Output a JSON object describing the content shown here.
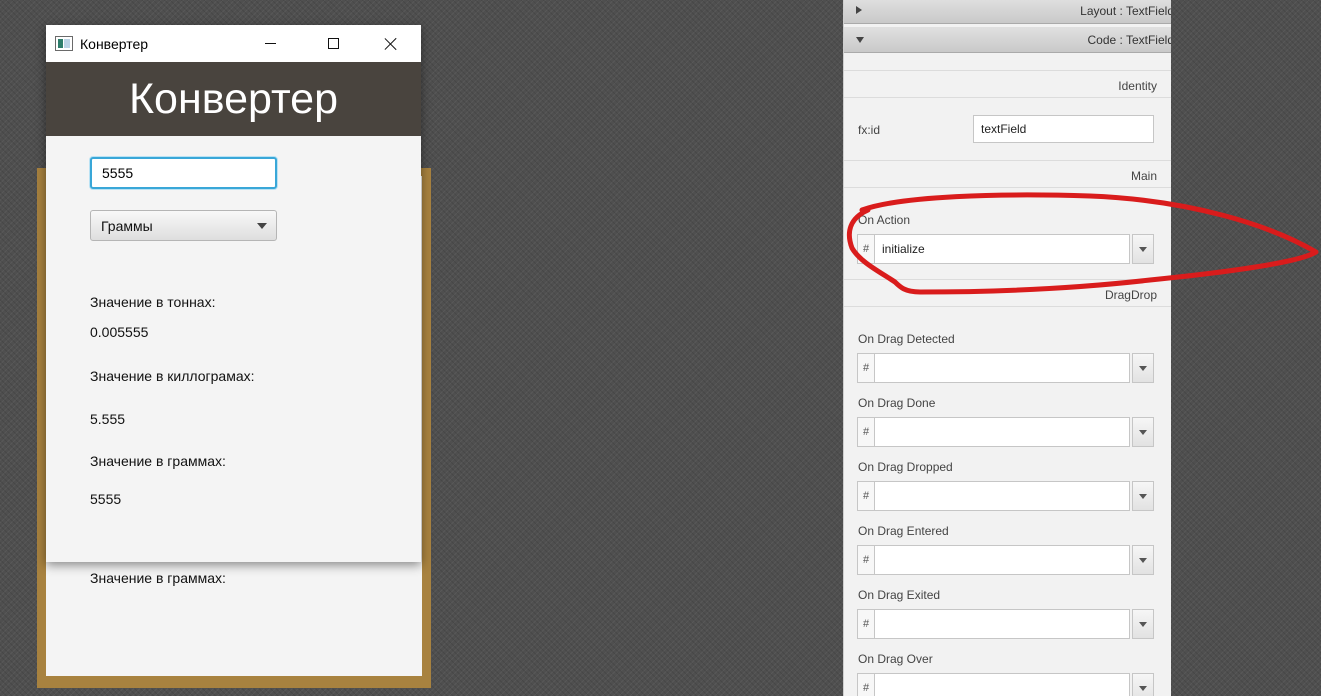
{
  "window": {
    "title": "Конвертер",
    "header_title": "Конвертер"
  },
  "form": {
    "input_value": "5555",
    "unit_selected": "Граммы",
    "tons_label": "Значение в тоннах:",
    "tons_value": "0.005555",
    "kilograms_label": "Значение в киллограмах:",
    "kilograms_value": "5.555",
    "grams_label": "Значение в граммах:",
    "grams_value": "5555"
  },
  "canvas": {
    "grams_label": "Значение в граммах:"
  },
  "inspector": {
    "layout_header": "Layout : TextField",
    "code_header": "Code : TextField",
    "identity_section": "Identity",
    "fxid_label": "fx:id",
    "fxid_value": "textField",
    "main_section": "Main",
    "on_action_label": "On Action",
    "on_action_value": "initialize",
    "dragdrop_section": "DragDrop",
    "hash": "#",
    "handlers": [
      {
        "label": "On Drag Detected",
        "value": ""
      },
      {
        "label": "On Drag Done",
        "value": ""
      },
      {
        "label": "On Drag Dropped",
        "value": ""
      },
      {
        "label": "On Drag Entered",
        "value": ""
      },
      {
        "label": "On Drag Exited",
        "value": ""
      },
      {
        "label": "On Drag Over",
        "value": ""
      }
    ]
  },
  "colors": {
    "header_bg": "#49443e",
    "frame_gold": "#a8823f",
    "focus_blue": "#39a7d8",
    "annotation_red": "#d91c1c"
  }
}
